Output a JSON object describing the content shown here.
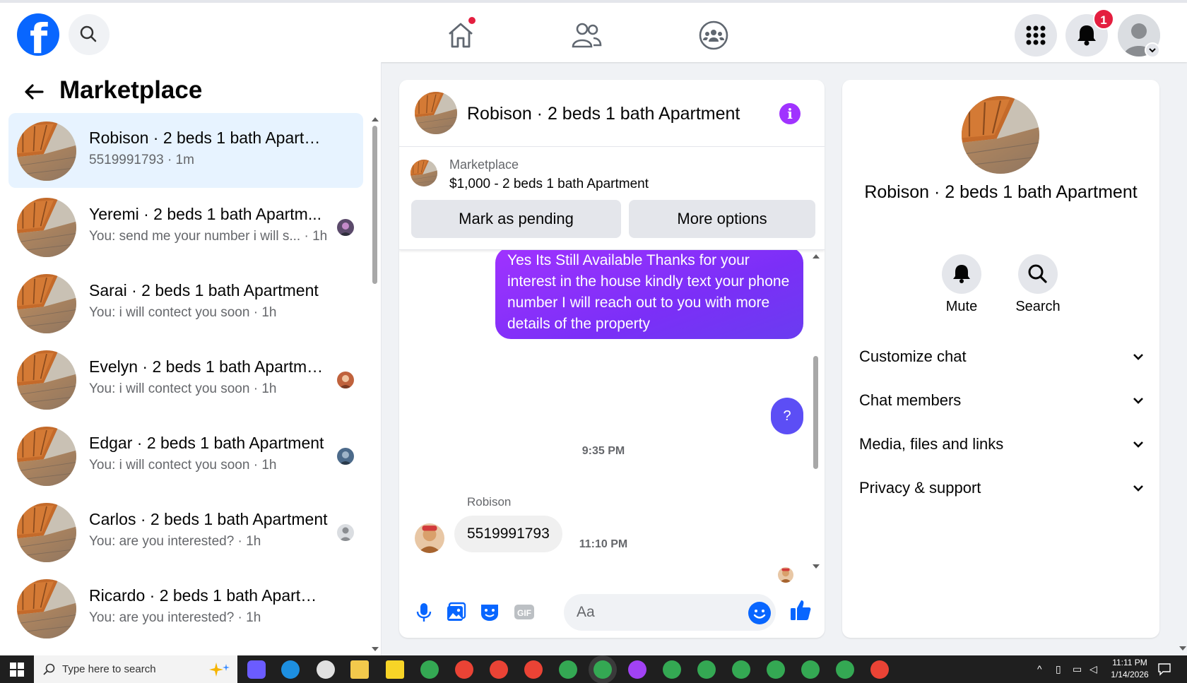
{
  "topnav": {
    "search_label": "Search Facebook",
    "notification_count": "1",
    "colors": {
      "brand": "#0866ff",
      "badge": "#e41e3f"
    }
  },
  "left": {
    "title": "Marketplace",
    "conversations": [
      {
        "name": "Robison · 2 beds 1 bath Apartment",
        "preview": "5519991793 · 1m",
        "active": true
      },
      {
        "name": "Yeremi · 2 beds 1 bath Apartm...",
        "preview": "You: send me your number i will s... · 1h"
      },
      {
        "name": "Sarai · 2 beds 1 bath Apartment",
        "preview": "You: i will contect you soon · 1h"
      },
      {
        "name": "Evelyn · 2 beds 1 bath Apartme...",
        "preview": "You: i will contect you soon · 1h"
      },
      {
        "name": "Edgar · 2 beds 1 bath Apartment",
        "preview": "You: i will contect you soon · 1h"
      },
      {
        "name": "Carlos · 2 beds 1 bath Apartment",
        "preview": "You: are you interested? · 1h"
      },
      {
        "name": "Ricardo · 2 beds 1 bath Apartment",
        "preview": "You: are you interested? · 1h"
      }
    ]
  },
  "chat": {
    "title": "Robison · 2 beds 1 bath Apartment",
    "listing": {
      "source": "Marketplace",
      "price_title": "$1,000 - 2 beds 1 bath Apartment",
      "mark_pending": "Mark as pending",
      "more_options": "More options"
    },
    "messages": {
      "outgoing_text": "Yes Its Still Available Thanks for your interest in the house kindly text your phone number I will reach out to you with more details of the property",
      "time1": "9:35 PM",
      "question": "?",
      "time2": "11:10 PM",
      "sender": "Robison",
      "incoming_text": "5519991793"
    },
    "composer": {
      "placeholder": "Aa"
    },
    "accent": "#a033ff"
  },
  "details": {
    "name": "Robison · 2 beds 1 bath Apartment",
    "mute_label": "Mute",
    "search_label": "Search",
    "sections": [
      "Customize chat",
      "Chat members",
      "Media, files and links",
      "Privacy & support"
    ]
  },
  "taskbar": {
    "search_placeholder": "Type here to search",
    "time": "11:11 PM",
    "date": "1/14/2026"
  }
}
